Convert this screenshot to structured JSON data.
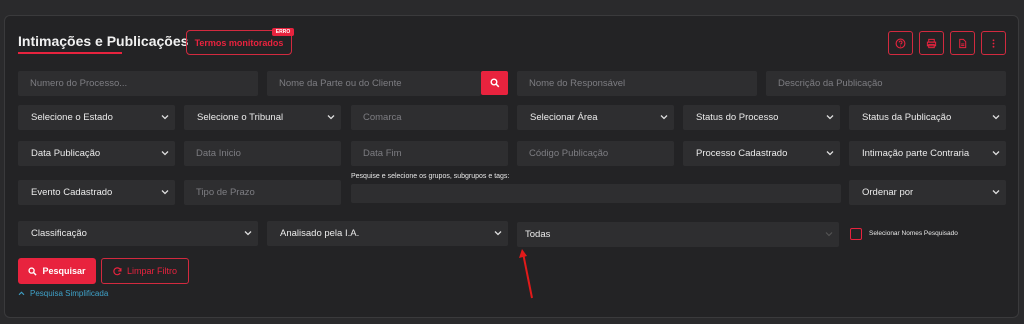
{
  "header": {
    "title": "Intimações e Publicações",
    "termos_label": "Termos monitorados",
    "erro_badge": "ERRO",
    "icons": [
      "help-icon",
      "print-icon",
      "document-icon",
      "more-vertical-icon"
    ]
  },
  "row1": {
    "numero_placeholder": "Numero do Processo...",
    "parte_placeholder": "Nome da Parte ou do Cliente",
    "responsavel_placeholder": "Nome do Responsável",
    "descricao_placeholder": "Descrição da Publicação"
  },
  "row2": {
    "estado": "Selecione o Estado",
    "tribunal": "Selecione o Tribunal",
    "comarca_placeholder": "Comarca",
    "area": "Selecionar Área",
    "status_processo": "Status do Processo",
    "status_publicacao": "Status da Publicação"
  },
  "row3": {
    "data_publicacao": "Data Publicação",
    "data_inicio_placeholder": "Data Inicio",
    "data_fim_placeholder": "Data Fim",
    "codigo_placeholder": "Código Publicação",
    "processo_cadastrado": "Processo Cadastrado",
    "intimacao_parte": "Intimação parte Contraria"
  },
  "row4": {
    "evento": "Evento Cadastrado",
    "tipo_prazo_placeholder": "Tipo de Prazo",
    "tags_label": "Pesquise e selecione os grupos, subgrupos e tags:",
    "ordenar": "Ordenar por"
  },
  "row5": {
    "classificacao": "Classificação",
    "analisado": "Analisado pela I.A.",
    "todas": "Todas",
    "selecionar_nomes": "Selecionar Nomes Pesquisado"
  },
  "actions": {
    "pesquisar": "Pesquisar",
    "limpar": "Limpar Filtro",
    "simplificada": "Pesquisa Simplificada"
  },
  "colors": {
    "accent": "#e8233e",
    "link": "#3fa2c9",
    "background": "#232325"
  }
}
